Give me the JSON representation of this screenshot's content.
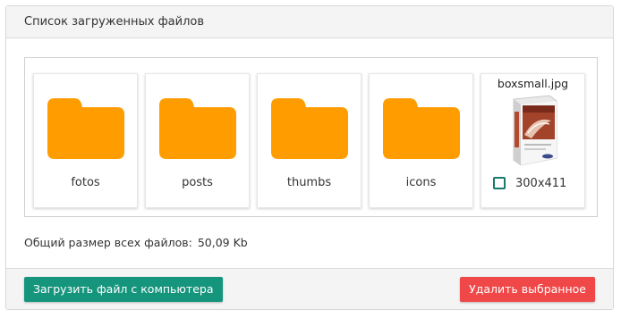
{
  "panel": {
    "title": "Список загруженных файлов"
  },
  "colors": {
    "folder": "#ff9c00",
    "upload_button": "#16957d",
    "delete_button": "#f04848",
    "checkbox_border": "#1a7a6a"
  },
  "items": [
    {
      "type": "folder",
      "icon": "folder-icon",
      "label": "fotos"
    },
    {
      "type": "folder",
      "icon": "folder-icon",
      "label": "posts"
    },
    {
      "type": "folder",
      "icon": "folder-icon",
      "label": "thumbs"
    },
    {
      "type": "folder",
      "icon": "folder-icon",
      "label": "icons"
    },
    {
      "type": "image",
      "filename": "boxsmall.jpg",
      "dimensions": "300x411",
      "selected": false
    }
  ],
  "summary": {
    "label": "Общий размер всех файлов:",
    "value": "50,09 Kb"
  },
  "footer": {
    "upload_label": "Загрузить файл с компьютера",
    "delete_label": "Удалить выбранное"
  }
}
